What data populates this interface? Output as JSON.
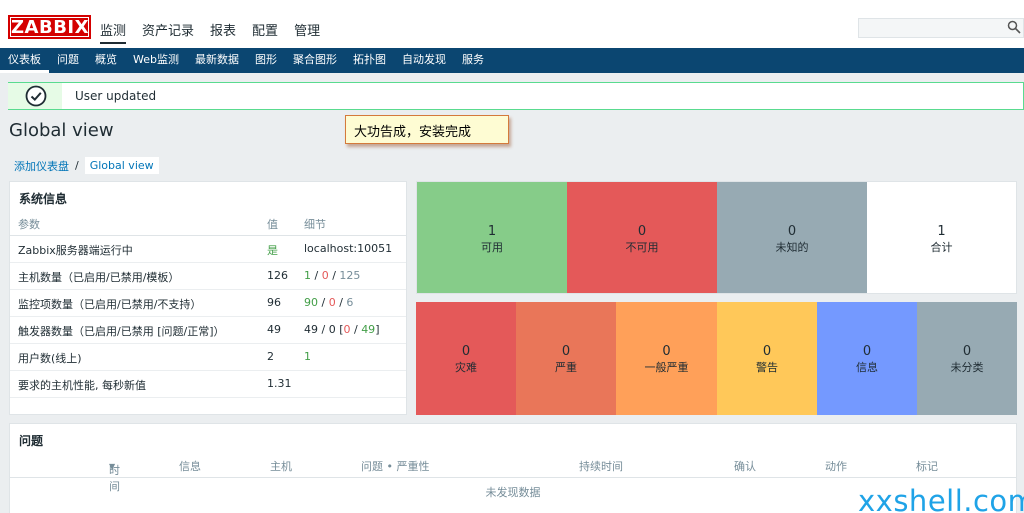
{
  "header": {
    "logo": "ZABBIX",
    "nav": [
      "监测",
      "资产记录",
      "报表",
      "配置",
      "管理"
    ],
    "active_nav": 0,
    "search_value": ""
  },
  "subnav": {
    "items": [
      "仪表板",
      "问题",
      "概览",
      "Web监测",
      "最新数据",
      "图形",
      "聚合图形",
      "拓扑图",
      "自动发现",
      "服务"
    ],
    "active": 0
  },
  "message": {
    "text": "User updated"
  },
  "page_title": "Global view",
  "callout": "大功告成，安装完成",
  "breadcrumb": {
    "parent": "添加仪表盘",
    "separator": "/",
    "current": "Global view"
  },
  "system_info": {
    "title": "系统信息",
    "headers": [
      "参数",
      "值",
      "细节"
    ],
    "rows": [
      {
        "param": "Zabbix服务器端运行中",
        "value": "是",
        "detail": "localhost:10051"
      },
      {
        "param": "主机数量（已启用/已禁用/模板）",
        "value": "126",
        "d1": "1",
        "s1": " / ",
        "d2": "0",
        "s2": " / ",
        "d3": "125"
      },
      {
        "param": "监控项数量（已启用/已禁用/不支持）",
        "value": "96",
        "d1": "90",
        "s1": " / ",
        "d2": "0",
        "s2": " / ",
        "d3": "6"
      },
      {
        "param": "触发器数量（已启用/已禁用 [问题/正常]）",
        "value": "49",
        "pre": "49 / 0 [",
        "d2": "0",
        "s2": " / ",
        "d3": "49",
        "post": "]"
      },
      {
        "param": "用户数(线上)",
        "value": "2",
        "detail": "1"
      },
      {
        "param": "要求的主机性能, 每秒新值",
        "value": "1.31",
        "detail": ""
      }
    ]
  },
  "host_status": [
    {
      "count": "1",
      "label": "可用",
      "color": "#86cc89"
    },
    {
      "count": "0",
      "label": "不可用",
      "color": "#e45959"
    },
    {
      "count": "0",
      "label": "未知的",
      "color": "#97aab3"
    },
    {
      "count": "1",
      "label": "合计",
      "color": "#ffffff"
    }
  ],
  "trigger_status": [
    {
      "count": "0",
      "label": "灾难",
      "color": "#e45959"
    },
    {
      "count": "0",
      "label": "严重",
      "color": "#e97659"
    },
    {
      "count": "0",
      "label": "一般严重",
      "color": "#ffa059"
    },
    {
      "count": "0",
      "label": "警告",
      "color": "#ffc859"
    },
    {
      "count": "0",
      "label": "信息",
      "color": "#7499ff"
    },
    {
      "count": "0",
      "label": "未分类",
      "color": "#97aab3"
    }
  ],
  "problems": {
    "title": "问题",
    "headers": [
      "时间",
      "信息",
      "主机",
      "问题 • 严重性",
      "持续时间",
      "确认",
      "动作",
      "标记"
    ],
    "sort_arrow": "▼",
    "empty_text": "未发现数据"
  },
  "watermark": "xxshell.com"
}
